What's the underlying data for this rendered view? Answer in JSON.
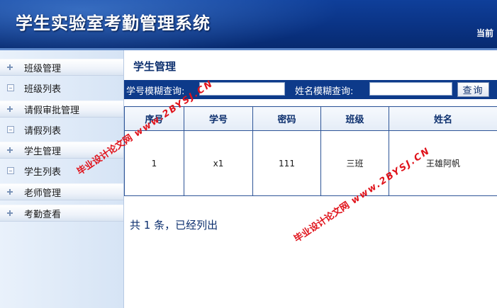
{
  "header": {
    "title": "学生实验室考勤管理系统",
    "current_user_label": "当前"
  },
  "sidebar": {
    "items": [
      {
        "label": "班级管理",
        "kind": "group",
        "icon": "plus-icon"
      },
      {
        "label": "班级列表",
        "kind": "child",
        "icon": "document-icon"
      },
      {
        "label": "请假审批管理",
        "kind": "group",
        "icon": "plus-icon"
      },
      {
        "label": "请假列表",
        "kind": "child",
        "icon": "document-icon"
      },
      {
        "label": "学生管理",
        "kind": "group",
        "icon": "plus-icon"
      },
      {
        "label": "学生列表",
        "kind": "child",
        "icon": "document-icon"
      },
      {
        "label": "老师管理",
        "kind": "group",
        "icon": "plus-icon"
      },
      {
        "label": "考勤查看",
        "kind": "group",
        "icon": "plus-icon"
      }
    ]
  },
  "main": {
    "page_title": "学生管理",
    "search": {
      "student_id_label": "学号模糊查询:",
      "student_id_value": "",
      "name_label": "姓名模糊查询:",
      "name_value": "",
      "button_label": "查询"
    },
    "table": {
      "columns": [
        "序号",
        "学号",
        "密码",
        "班级",
        "姓名"
      ],
      "rows": [
        {
          "index": "1",
          "student_id": "x1",
          "password": "111",
          "class": "三班",
          "name": "王雄阿帆"
        }
      ]
    },
    "summary": "共 1 条，已经列出"
  },
  "watermark": {
    "cn_text": "毕业设计论文网",
    "url_text": "www.2BYSJ.CN",
    "color": "#e0121a"
  },
  "colors": {
    "header_bg": "#0a3384",
    "search_bar_bg": "#0d3a8a",
    "table_border": "#2e5597",
    "title_text": "#0c2f6e"
  }
}
